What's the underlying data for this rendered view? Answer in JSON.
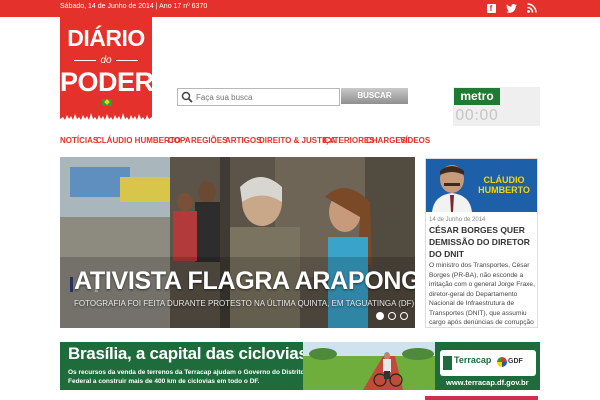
{
  "topbar": {
    "date_line": "Sábado, 14 de Junho de 2014   |   Ano 17 nº 6370",
    "icons": [
      "facebook-icon",
      "twitter-icon",
      "rss-icon"
    ]
  },
  "logo": {
    "line1": "DIÁRIO",
    "line2": "do",
    "line3": "PODER"
  },
  "search": {
    "placeholder": "Faça sua busca",
    "button": "BUSCAR"
  },
  "metro": {
    "logo": "metro",
    "clock": "00:00"
  },
  "nav": {
    "items": [
      "NOTÍCIAS",
      "CLÁUDIO HUMBERTO",
      "COPA",
      "REGIÕES",
      "ARTIGOS",
      "DIREITO & JUSTIÇA",
      "EXTERIORES",
      "CHARGES",
      "VÍDEOS"
    ]
  },
  "hero": {
    "headline": "ATIVISTA FLAGRA ARAPONGA",
    "caption": "FOTOGRAFIA FOI FEITA DURANTE PROTESTO NA ÚLTIMA QUINTA, EM TAGUATINGA (DF)",
    "slides": 3,
    "active_slide": 1
  },
  "columnist": {
    "name_line1": "CLÁUDIO",
    "name_line2": "HUMBERTO",
    "date": "14 de Junho de 2014",
    "title": "CÉSAR BORGES QUER DEMISSÃO DO DIRETOR DO DNIT",
    "body": "O ministro dos Transportes, César Borges (PR-BA), não esconde a irritação com o general Jorge Fraxe, diretor-geral do Departamento Nacional de Infraestrutura de Transportes (DNIT), que assumiu cargo após denúncias de corrupção"
  },
  "ad": {
    "title": "Brasília, a capital das ciclovias.",
    "text": "Os recursos da venda de terrenos da Terracap ajudam o Governo do Distrito Federal a construir mais de 400 km de ciclovias em todo o DF.",
    "brand": "Terracap",
    "brand2": "GDF",
    "url": "www.terracap.df.gov.br"
  },
  "colors": {
    "brand_red": "#e5312b",
    "columnist_blue": "#1d5fa8",
    "metro_green": "#1f7a34",
    "ad_green": "#1e6b3c"
  }
}
